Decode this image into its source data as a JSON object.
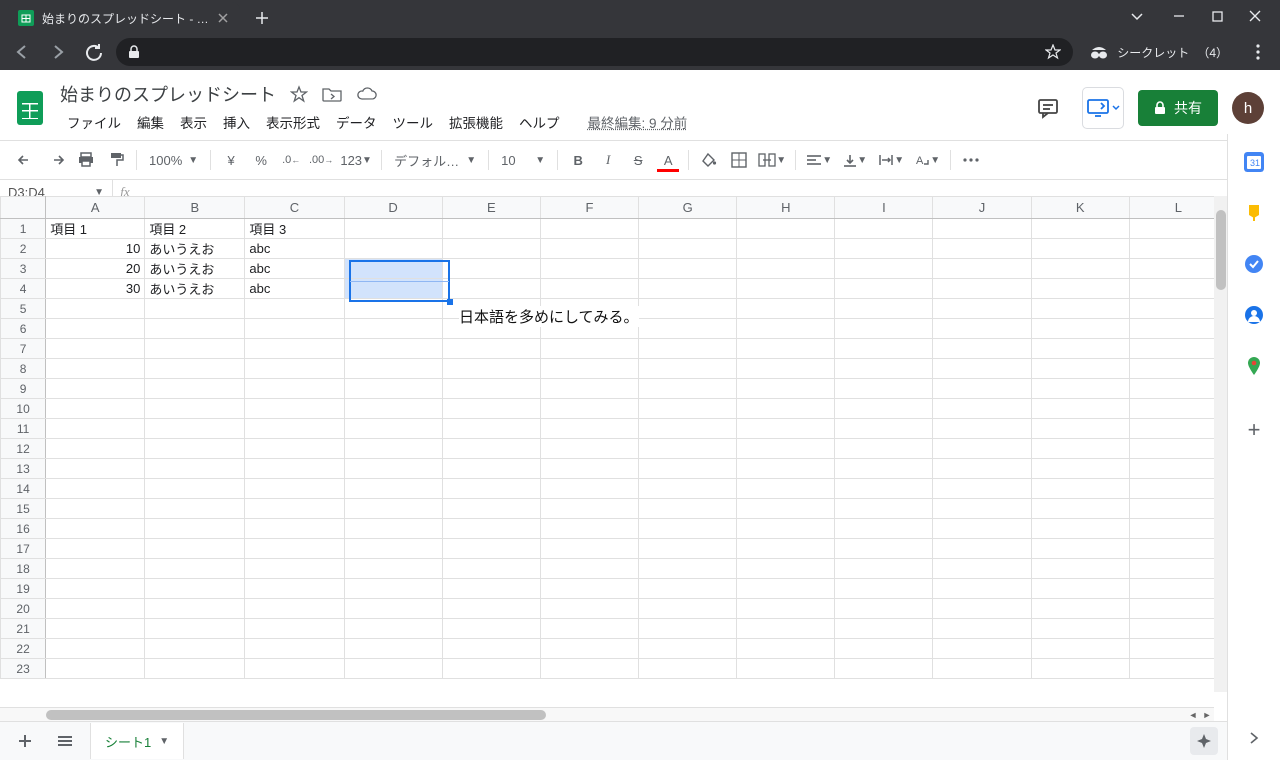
{
  "browser": {
    "tab_title": "始まりのスプレッドシート - Google ス",
    "incognito_label": "シークレット",
    "incognito_count": "（4）"
  },
  "header": {
    "title": "始まりのスプレッドシート",
    "menus": [
      "ファイル",
      "編集",
      "表示",
      "挿入",
      "表示形式",
      "データ",
      "ツール",
      "拡張機能",
      "ヘルプ"
    ],
    "last_edit": "最終編集: 9 分前",
    "share": "共有",
    "avatar": "h"
  },
  "toolbar": {
    "zoom": "100%",
    "currency": "¥",
    "percent": "%",
    "dec_dec": ".0",
    "dec_inc": ".00",
    "numfmt": "123",
    "font": "デフォルト...",
    "size": "10"
  },
  "namebox": "D3:D4",
  "columns": [
    "A",
    "B",
    "C",
    "D",
    "E",
    "F",
    "G",
    "H",
    "I",
    "J",
    "K",
    "L"
  ],
  "rows": 23,
  "cells": {
    "A1": "項目 1",
    "B1": "項目 2",
    "C1": "項目 3",
    "A2": "10",
    "B2": "あいうえお",
    "C2": "abc",
    "A3": "20",
    "B3": "あいうえお",
    "C3": "abc",
    "A4": "30",
    "B4": "あいうえお",
    "C4": "abc"
  },
  "numeric_cells": [
    "A2",
    "A3",
    "A4"
  ],
  "selection": {
    "col": "D",
    "r1": 3,
    "r2": 4
  },
  "floating_note": "日本語を多めにしてみる。",
  "sheet_tab": "シート1"
}
